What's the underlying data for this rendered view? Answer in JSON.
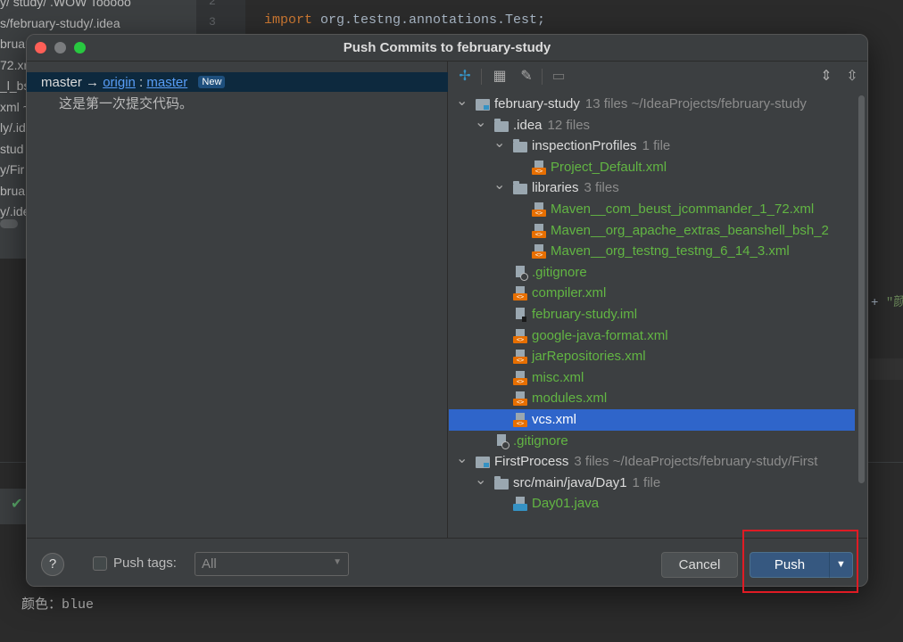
{
  "background": {
    "project_lines": [
      "y/ study/ .WOW Tooooo",
      "s/february-study/.idea",
      "bruar",
      "72.xr",
      "_l_bs",
      "xml ~",
      "ly/.id",
      "stud",
      "y/Fir",
      "brua",
      "y/.ide"
    ],
    "gutter_numbers": [
      "2",
      "3"
    ],
    "code_keyword": "import",
    "code_rest": " org.testng.annotations.Test;",
    "code_fragment_plus": "+ ",
    "code_fragment_str": "\"颜",
    "run_output": "颜色：blue"
  },
  "dialog": {
    "title": "Push Commits to february-study"
  },
  "commits": {
    "local_branch": "master",
    "arrow": "→",
    "remote": "origin",
    "separator": ":",
    "remote_branch": "master",
    "badge": "New",
    "message": "这是第一次提交代码。"
  },
  "toolbar": {
    "icons": [
      "expand-pin-icon",
      "group-by-icon",
      "edit-source-icon",
      "show-diff-icon",
      "expand-all-icon",
      "collapse-all-icon"
    ]
  },
  "tree": [
    {
      "type": "module",
      "name": "february-study",
      "meta": "13 files  ~/IdeaProjects/february-study",
      "color": "white",
      "indent": 0,
      "expanded": true
    },
    {
      "type": "folder",
      "name": ".idea",
      "meta": "12 files",
      "color": "white",
      "indent": 1,
      "expanded": true
    },
    {
      "type": "folder",
      "name": "inspectionProfiles",
      "meta": "1 file",
      "color": "white",
      "indent": 2,
      "expanded": true
    },
    {
      "type": "xml",
      "name": "Project_Default.xml",
      "meta": "",
      "color": "green",
      "indent": 3
    },
    {
      "type": "folder",
      "name": "libraries",
      "meta": "3 files",
      "color": "white",
      "indent": 2,
      "expanded": true
    },
    {
      "type": "xml",
      "name": "Maven__com_beust_jcommander_1_72.xml",
      "meta": "",
      "color": "green",
      "indent": 3
    },
    {
      "type": "xml",
      "name": "Maven__org_apache_extras_beanshell_bsh_2",
      "meta": "",
      "color": "green",
      "indent": 3
    },
    {
      "type": "xml",
      "name": "Maven__org_testng_testng_6_14_3.xml",
      "meta": "",
      "color": "green",
      "indent": 3
    },
    {
      "type": "git",
      "name": ".gitignore",
      "meta": "",
      "color": "green",
      "indent": 2
    },
    {
      "type": "xml",
      "name": "compiler.xml",
      "meta": "",
      "color": "green",
      "indent": 2
    },
    {
      "type": "iml",
      "name": "february-study.iml",
      "meta": "",
      "color": "green",
      "indent": 2
    },
    {
      "type": "xml",
      "name": "google-java-format.xml",
      "meta": "",
      "color": "green",
      "indent": 2
    },
    {
      "type": "xml",
      "name": "jarRepositories.xml",
      "meta": "",
      "color": "green",
      "indent": 2
    },
    {
      "type": "xml",
      "name": "misc.xml",
      "meta": "",
      "color": "green",
      "indent": 2
    },
    {
      "type": "xml",
      "name": "modules.xml",
      "meta": "",
      "color": "green",
      "indent": 2
    },
    {
      "type": "xml",
      "name": "vcs.xml",
      "meta": "",
      "color": "green",
      "indent": 2,
      "selected": true
    },
    {
      "type": "git",
      "name": ".gitignore",
      "meta": "",
      "color": "green",
      "indent": 1
    },
    {
      "type": "module",
      "name": "FirstProcess",
      "meta": "3 files  ~/IdeaProjects/february-study/First",
      "color": "white",
      "indent": 0,
      "expanded": true
    },
    {
      "type": "folder",
      "name": "src/main/java/Day1",
      "meta": "1 file",
      "color": "white",
      "indent": 1,
      "expanded": true
    },
    {
      "type": "java",
      "name": "Day01.java",
      "meta": "",
      "color": "green",
      "indent": 2
    }
  ],
  "footer": {
    "help": "?",
    "push_tags_label": "Push tags:",
    "push_tags_checked": false,
    "tags_select_value": "All",
    "cancel_label": "Cancel",
    "push_label": "Push"
  },
  "colors": {
    "accent": "#2f65ca",
    "highlight_box": "#e01b24",
    "added_file": "#62b543"
  }
}
